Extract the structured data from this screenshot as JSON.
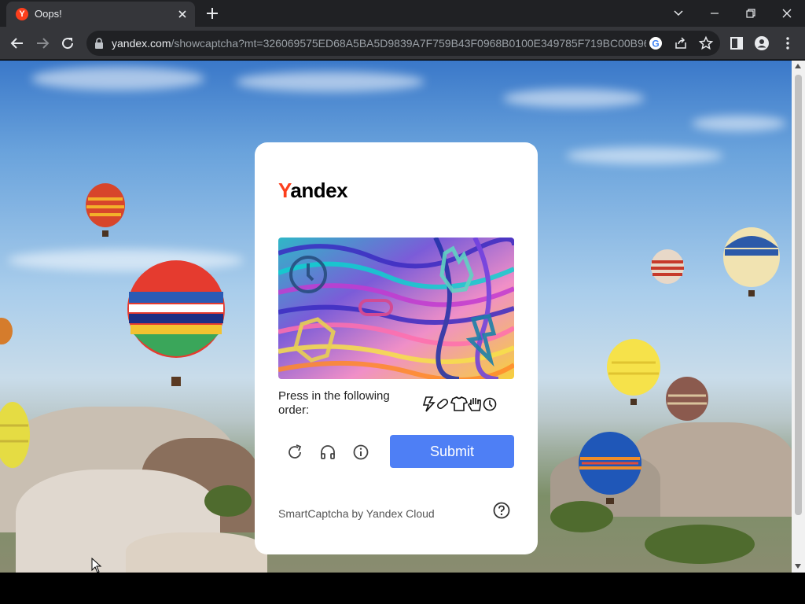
{
  "browser": {
    "tab_title": "Oops!",
    "favicon_letter": "Y",
    "url_host": "yandex.com",
    "url_path": "/showcaptcha?mt=326069575ED68A5BA5D9839A7F759B43F0968B0100E349785F719BC00B969..."
  },
  "captcha": {
    "brand": "Yandex",
    "brand_first_letter": "Y",
    "brand_rest": "andex",
    "instruction": "Press in the following order:",
    "order_icons": [
      "lightning-icon",
      "link-icon",
      "tshirt-icon",
      "hand-icon",
      "clock-icon"
    ],
    "submit_label": "Submit",
    "footer": "SmartCaptcha by Yandex Cloud",
    "accent_color": "#4e7ff5",
    "brand_color": "#fc3f1d"
  },
  "icons": {
    "toolbar": [
      "back-icon",
      "forward-icon",
      "reload-icon",
      "lock-icon",
      "google-icon",
      "share-icon",
      "star-icon",
      "side-panel-icon",
      "profile-icon",
      "menu-icon"
    ],
    "captcha_controls": [
      "refresh-icon",
      "headphones-icon",
      "info-icon",
      "help-icon"
    ]
  }
}
